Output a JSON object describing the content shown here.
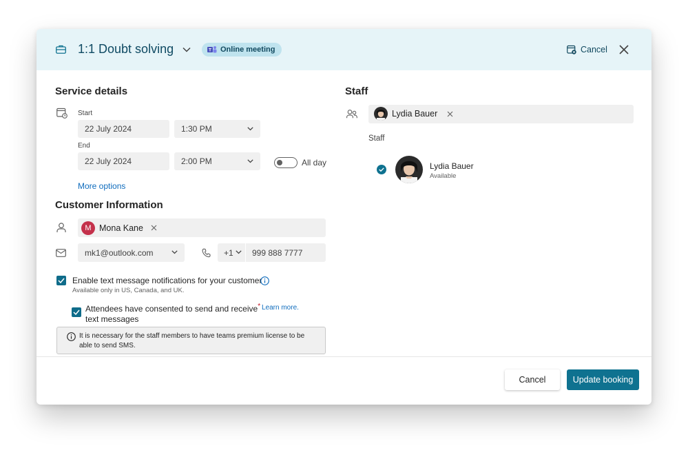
{
  "header": {
    "title": "1:1 Doubt solving",
    "badge": "Online meeting",
    "cancel_label": "Cancel",
    "bg_color": "#e6f4f8",
    "accent_color": "#0f7290"
  },
  "service_details": {
    "title": "Service details",
    "start_label": "Start",
    "start_date": "22 July 2024",
    "start_time": "1:30 PM",
    "end_label": "End",
    "end_date": "22 July 2024",
    "end_time": "2:00 PM",
    "all_day_label": "All day",
    "all_day_on": false,
    "more_options": "More options"
  },
  "customer": {
    "title": "Customer Information",
    "name_initial": "M",
    "name": "Mona Kane",
    "email": "mk1@outlook.com",
    "country_code": "+1",
    "phone": "999 888 7777",
    "sms_label": "Enable text message notifications for your customer",
    "sms_sub": "Available only in US, Canada, and UK.",
    "consent_label_line1": "Attendees have consented to send and receive",
    "consent_label_line2": "text messages",
    "required_mark": "*",
    "learn_more": "Learn more.",
    "info_text": "It is necessary for the staff members to have teams premium license to be able to send SMS."
  },
  "staff": {
    "title": "Staff",
    "selected_name": "Lydia Bauer",
    "list_title": "Staff",
    "member_name": "Lydia Bauer",
    "member_status": "Available"
  },
  "footer": {
    "cancel_label": "Cancel",
    "update_label": "Update booking"
  }
}
